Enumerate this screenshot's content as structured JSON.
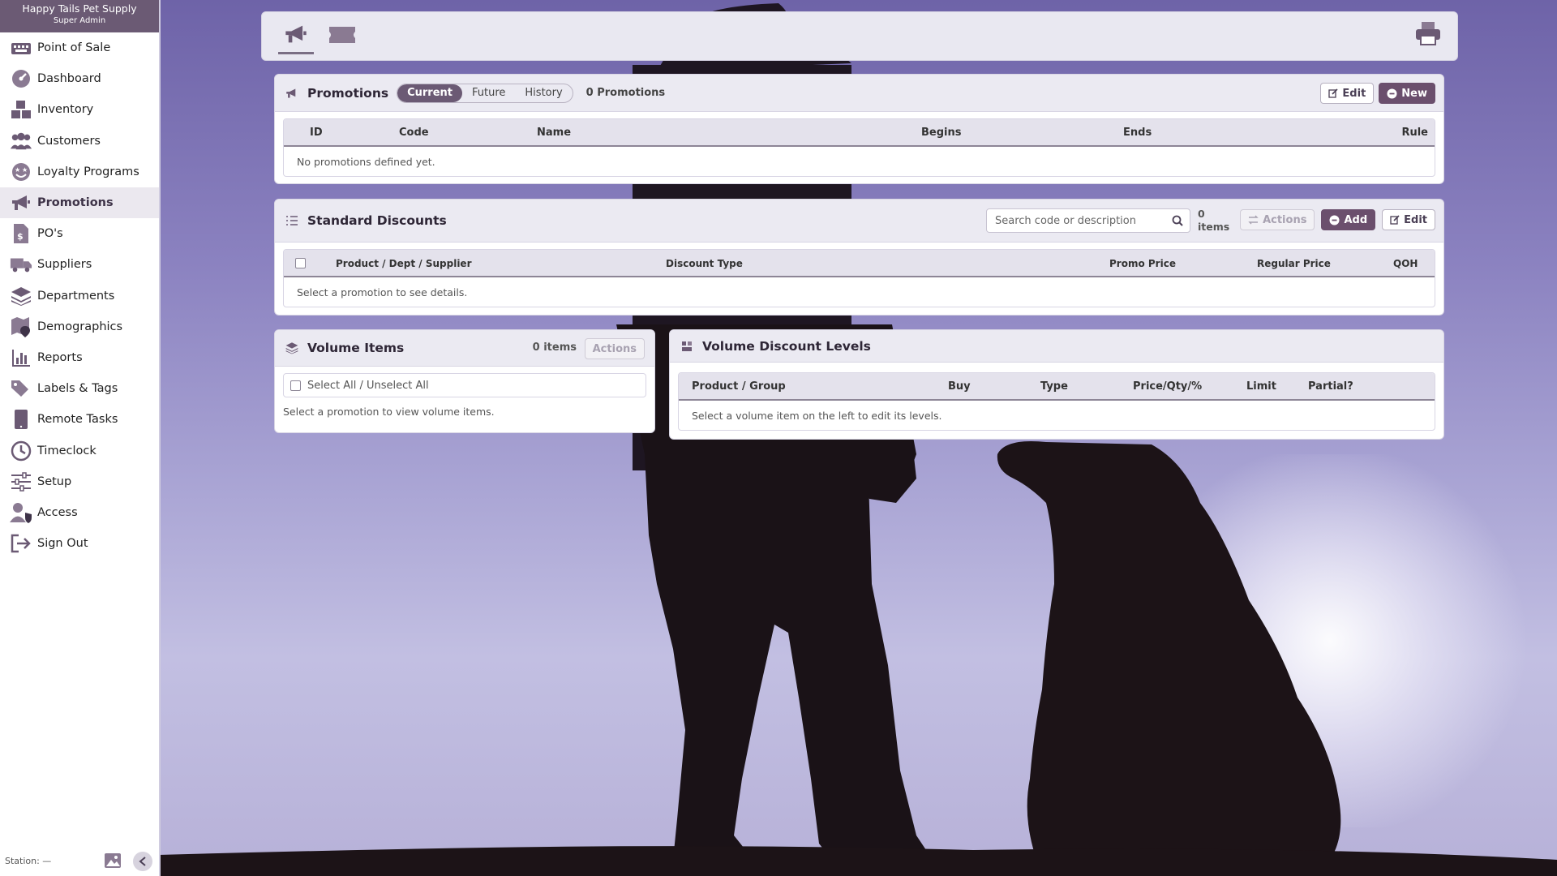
{
  "sidebar": {
    "store_name": "Happy Tails Pet Supply",
    "role": "Super Admin",
    "items": [
      {
        "label": "Point of Sale",
        "icon": "keyboard-icon"
      },
      {
        "label": "Dashboard",
        "icon": "gauge-icon"
      },
      {
        "label": "Inventory",
        "icon": "boxes-icon"
      },
      {
        "label": "Customers",
        "icon": "users-icon"
      },
      {
        "label": "Loyalty Programs",
        "icon": "star-face-icon"
      },
      {
        "label": "Promotions",
        "icon": "megaphone-icon",
        "active": true
      },
      {
        "label": "PO's",
        "icon": "invoice-icon"
      },
      {
        "label": "Suppliers",
        "icon": "truck-icon"
      },
      {
        "label": "Departments",
        "icon": "layers-icon"
      },
      {
        "label": "Demographics",
        "icon": "map-pin-icon"
      },
      {
        "label": "Reports",
        "icon": "bar-chart-icon"
      },
      {
        "label": "Labels & Tags",
        "icon": "tags-icon"
      },
      {
        "label": "Remote Tasks",
        "icon": "tablet-icon"
      },
      {
        "label": "Timeclock",
        "icon": "clock-icon"
      },
      {
        "label": "Setup",
        "icon": "sliders-icon"
      },
      {
        "label": "Access",
        "icon": "user-shield-icon"
      },
      {
        "label": "Sign Out",
        "icon": "sign-out-icon"
      }
    ],
    "station_label": "Station: —"
  },
  "toolbar": {
    "tabs": [
      {
        "icon": "megaphone-icon",
        "active": true
      },
      {
        "icon": "ticket-icon",
        "active": false
      }
    ],
    "print_icon": "printer-icon"
  },
  "promotions": {
    "title": "Promotions",
    "segments": [
      "Current",
      "Future",
      "History"
    ],
    "active_segment": "Current",
    "count_text": "0 Promotions",
    "edit_label": "Edit",
    "new_label": "New",
    "columns": [
      "ID",
      "Code",
      "Name",
      "Begins",
      "Ends",
      "Rule"
    ],
    "empty_text": "No promotions defined yet."
  },
  "standard_discounts": {
    "title": "Standard Discounts",
    "search_placeholder": "Search code or description",
    "count_number": "0",
    "count_unit": "items",
    "actions_label": "Actions",
    "add_label": "Add",
    "edit_label": "Edit",
    "columns": [
      "Product / Dept / Supplier",
      "Discount Type",
      "Promo Price",
      "Regular Price",
      "QOH"
    ],
    "empty_text": "Select a promotion to see details."
  },
  "volume_items": {
    "title": "Volume Items",
    "count_text": "0 items",
    "actions_label": "Actions",
    "select_all_label": "Select All / Unselect All",
    "empty_text": "Select a promotion to view volume items."
  },
  "volume_levels": {
    "title": "Volume Discount Levels",
    "columns": [
      "Product / Group",
      "Buy",
      "Type",
      "Price/Qty/%",
      "Limit",
      "Partial?"
    ],
    "empty_text": "Select a volume item on the left to edit its levels."
  },
  "colors": {
    "accent": "#6b5a74",
    "button_fill": "#6b4f6d",
    "panel_header": "#ebeaf2"
  }
}
